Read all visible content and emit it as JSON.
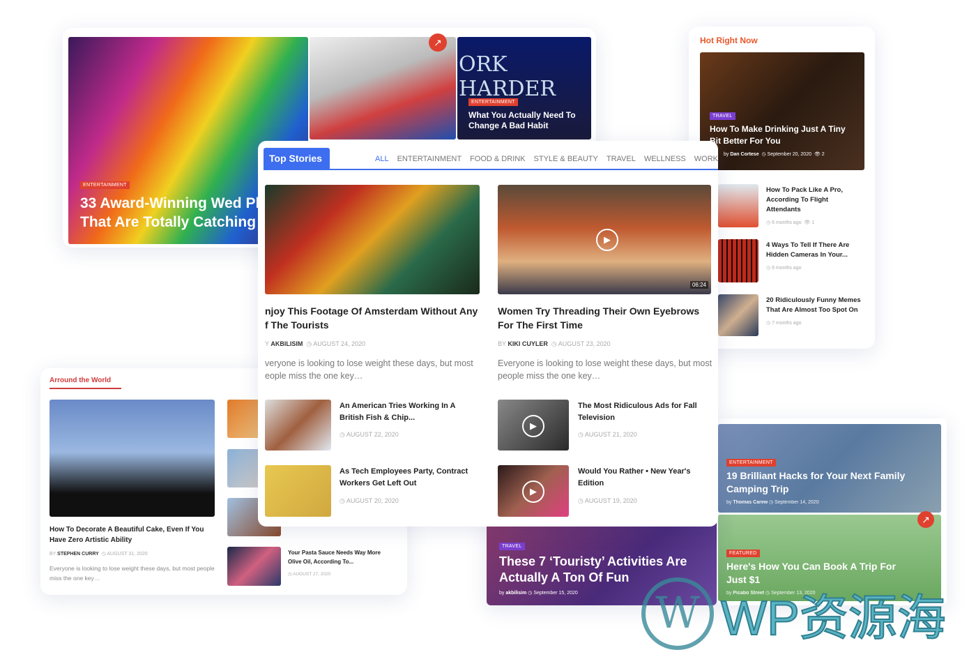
{
  "hero": {
    "tag1": "ENTERTAINMENT",
    "title1": "33 Award-Winning Wed Photos That Are Totally Catching",
    "tag2": "ENTERTAINMENT",
    "title2": "What You Actually Need To Change A Bad Habit",
    "img_text": "ORK HARDER"
  },
  "hot": {
    "heading": "Hot Right Now",
    "feature": {
      "tag": "TRAVEL",
      "title": "How To Make Drinking Just A Tiny Bit Better For You",
      "by": "by",
      "author": "Dan Cortese",
      "date": "September 20, 2020",
      "views": "2"
    },
    "items": [
      {
        "title": "How To Pack Like A Pro, According To Flight Attendants",
        "time": "6 months ago",
        "views": "1"
      },
      {
        "title": "4 Ways To Tell If There Are Hidden Cameras In Your...",
        "time": "6 months ago"
      },
      {
        "title": "20 Ridiculously Funny Memes That Are Almost Too Spot On",
        "time": "7 months ago"
      }
    ]
  },
  "world": {
    "heading": "Arround the World",
    "feature": {
      "title": "How To Decorate A Beautiful Cake, Even If You Have Zero Artistic Ability",
      "by": "BY",
      "author": "STEPHEN CURRY",
      "date": "AUGUST 31, 2020",
      "excerpt": "Everyone is looking to lose weight these days, but most people miss the one key…"
    },
    "item": {
      "title": "Your Pasta Sauce Needs Way More Olive Oil, According To...",
      "date": "AUGUST 27, 2020"
    }
  },
  "top": {
    "title": "Top Stories",
    "tabs": [
      "ALL",
      "ENTERTAINMENT",
      "FOOD & DRINK",
      "STYLE & BEAUTY",
      "TRAVEL",
      "WELLNESS",
      "WORK & LIFE"
    ],
    "main": [
      {
        "title": "njoy This Footage Of Amsterdam Without Any\nf The Tourists",
        "by": "Y",
        "author": "AKBILISIM",
        "date": "AUGUST 24, 2020",
        "excerpt": "veryone is looking to lose weight these days, but most eople miss the one key…"
      },
      {
        "title": "Women Try Threading Their Own Eyebrows For The First Time",
        "by": "BY",
        "author": "KIKI CUYLER",
        "date": "AUGUST 23, 2020",
        "excerpt": "Everyone is looking to lose weight these days, but most people miss the one key…",
        "duration": "06:24"
      }
    ],
    "list": [
      {
        "title": "An American Tries Working In A British Fish & Chip...",
        "date": "AUGUST 22, 2020"
      },
      {
        "title": "The Most Ridiculous Ads for Fall Television",
        "date": "AUGUST 21, 2020"
      },
      {
        "title": "As Tech Employees Party, Contract Workers Get Left Out",
        "date": "AUGUST 20, 2020"
      },
      {
        "title": "Would You Rather • New Year's Edition",
        "date": "AUGUST 19, 2020"
      }
    ]
  },
  "travel": {
    "tag": "TRAVEL",
    "title": "These 7 ‘Touristy’ Activities Are Actually A Ton Of Fun",
    "by": "by",
    "author": "akbilisim",
    "date": "September 15, 2020"
  },
  "right": [
    {
      "tag": "ENTERTAINMENT",
      "title": "19 Brilliant Hacks for Your Next Family Camping Trip",
      "by": "by",
      "author": "Thomas Carew",
      "date": "September 14, 2020"
    },
    {
      "tag": "FEATURED",
      "title": "Here's How You Can Book A Trip For Just $1",
      "by": "by",
      "author": "Picabo Street",
      "date": "September 13, 2020"
    }
  ],
  "watermark": "WP资源海",
  "colors": {
    "accent": "#3d6ef0",
    "red": "#e0412f",
    "purple": "#7b3fd0"
  }
}
